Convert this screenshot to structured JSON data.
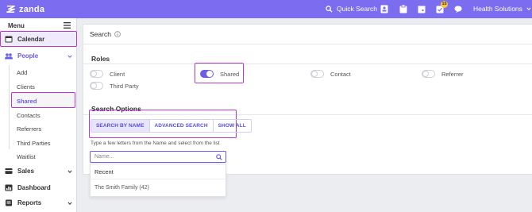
{
  "topbar": {
    "brand": "zanda",
    "quick_search": "Quick Search",
    "notification_count": "15",
    "organization": "Health Solutions",
    "colors": {
      "bar": "#7b6cf0",
      "accent": "#6b5de8",
      "highlight": "#b43ac9"
    }
  },
  "sidebar": {
    "menu_label": "Menu",
    "items": [
      {
        "label": "Calendar",
        "icon": "calendar-icon"
      },
      {
        "label": "People",
        "icon": "people-icon"
      },
      {
        "label": "Sales",
        "icon": "sales-icon"
      },
      {
        "label": "Dashboard",
        "icon": "dashboard-icon"
      },
      {
        "label": "Reports",
        "icon": "reports-icon"
      }
    ],
    "people_sub": [
      "Add",
      "Clients",
      "Shared",
      "Contacts",
      "Referrers",
      "Third Parties",
      "Waitlist"
    ]
  },
  "main": {
    "title": "Search",
    "roles": {
      "title": "Roles",
      "items": [
        {
          "label": "Client",
          "on": false
        },
        {
          "label": "Shared",
          "on": true
        },
        {
          "label": "Contact",
          "on": false
        },
        {
          "label": "Referrer",
          "on": false
        },
        {
          "label": "Third Party",
          "on": false
        }
      ]
    },
    "search_options": {
      "title": "Search Options",
      "tabs": [
        "SEARCH BY NAME",
        "ADVANCED SEARCH",
        "SHOW ALL"
      ],
      "active_tab": "SEARCH BY NAME",
      "hint": "Type a few letters from the Name and select from the list",
      "placeholder": "Name...",
      "value": ""
    },
    "recent": {
      "title": "Recent",
      "items": [
        "The Smith Family (42)"
      ]
    }
  }
}
